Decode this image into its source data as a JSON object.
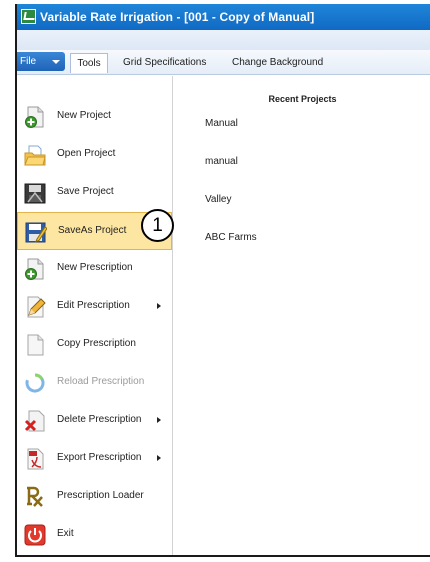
{
  "window": {
    "title": "Variable Rate Irrigation - [001 - Copy of Manual]"
  },
  "ribbon": {
    "file_label": "File",
    "tabs": [
      "Tools",
      "Grid Specifications",
      "Change Background"
    ]
  },
  "menu": {
    "items": [
      {
        "label": "New Project",
        "icon": "new-project-icon"
      },
      {
        "label": "Open Project",
        "icon": "open-folder-icon"
      },
      {
        "label": "Save Project",
        "icon": "save-project-icon"
      },
      {
        "label": "SaveAs Project",
        "icon": "save-as-icon",
        "selected": true
      },
      {
        "label": "New Prescription",
        "icon": "new-prescription-icon"
      },
      {
        "label": "Edit Prescription",
        "icon": "edit-pencil-icon",
        "submenu": true
      },
      {
        "label": "Copy Prescription",
        "icon": "copy-document-icon"
      },
      {
        "label": "Reload Prescription",
        "icon": "reload-icon",
        "disabled": true
      },
      {
        "label": "Delete Prescription",
        "icon": "delete-icon",
        "submenu": true
      },
      {
        "label": "Export Prescription",
        "icon": "export-pdf-icon",
        "submenu": true
      },
      {
        "label": "Prescription Loader",
        "icon": "rx-icon"
      },
      {
        "label": "Exit",
        "icon": "power-icon"
      }
    ]
  },
  "recent_projects": {
    "title": "Recent Projects",
    "items": [
      "Manual",
      "manual",
      "Valley",
      "ABC Farms"
    ]
  },
  "callout": {
    "label": "1"
  },
  "colors": {
    "title_bar": "#1a78d2",
    "file_tab": "#2a73c8",
    "selected_item": "#fde6a2",
    "selected_border": "#e3b44c"
  }
}
